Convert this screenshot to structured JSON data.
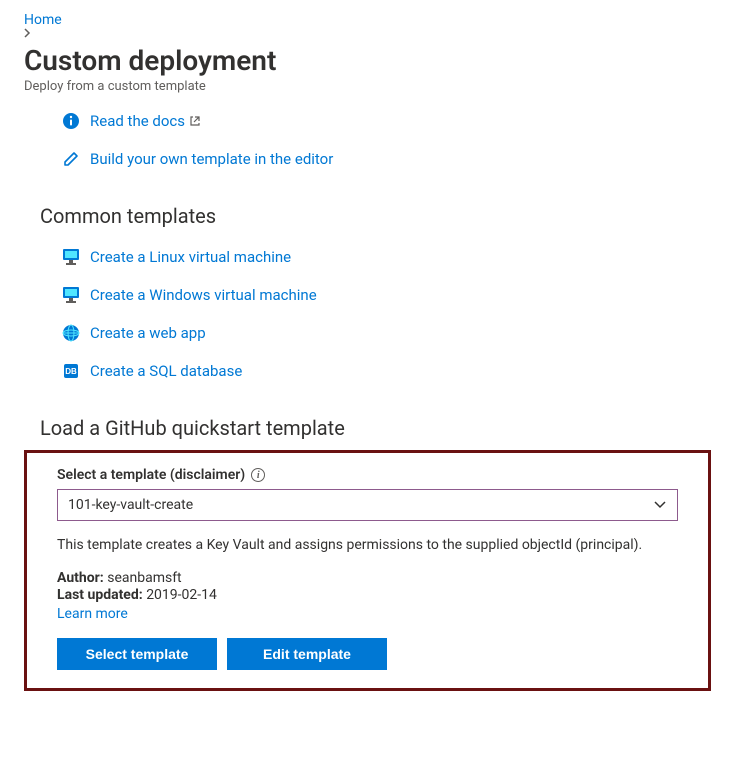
{
  "breadcrumb": {
    "home": "Home"
  },
  "header": {
    "title": "Custom deployment",
    "subtitle": "Deploy from a custom template"
  },
  "top_links": [
    {
      "name": "read-docs",
      "label": "Read the docs",
      "external": true,
      "icon": "info"
    },
    {
      "name": "build-template",
      "label": "Build your own template in the editor",
      "external": false,
      "icon": "pencil"
    }
  ],
  "common_section": {
    "heading": "Common templates",
    "items": [
      {
        "name": "linux-vm",
        "label": "Create a Linux virtual machine",
        "icon": "vm"
      },
      {
        "name": "windows-vm",
        "label": "Create a Windows virtual machine",
        "icon": "vm"
      },
      {
        "name": "web-app",
        "label": "Create a web app",
        "icon": "globe"
      },
      {
        "name": "sql-db",
        "label": "Create a SQL database",
        "icon": "db"
      }
    ]
  },
  "quickstart": {
    "heading": "Load a GitHub quickstart template",
    "field_label": "Select a template (disclaimer)",
    "selected": "101-key-vault-create",
    "description": "This template creates a Key Vault and assigns permissions to the supplied objectId (principal).",
    "author_label": "Author:",
    "author": "seanbamsft",
    "updated_label": "Last updated:",
    "updated": "2019-02-14",
    "learn_more": "Learn more",
    "select_button": "Select template",
    "edit_button": "Edit template"
  }
}
